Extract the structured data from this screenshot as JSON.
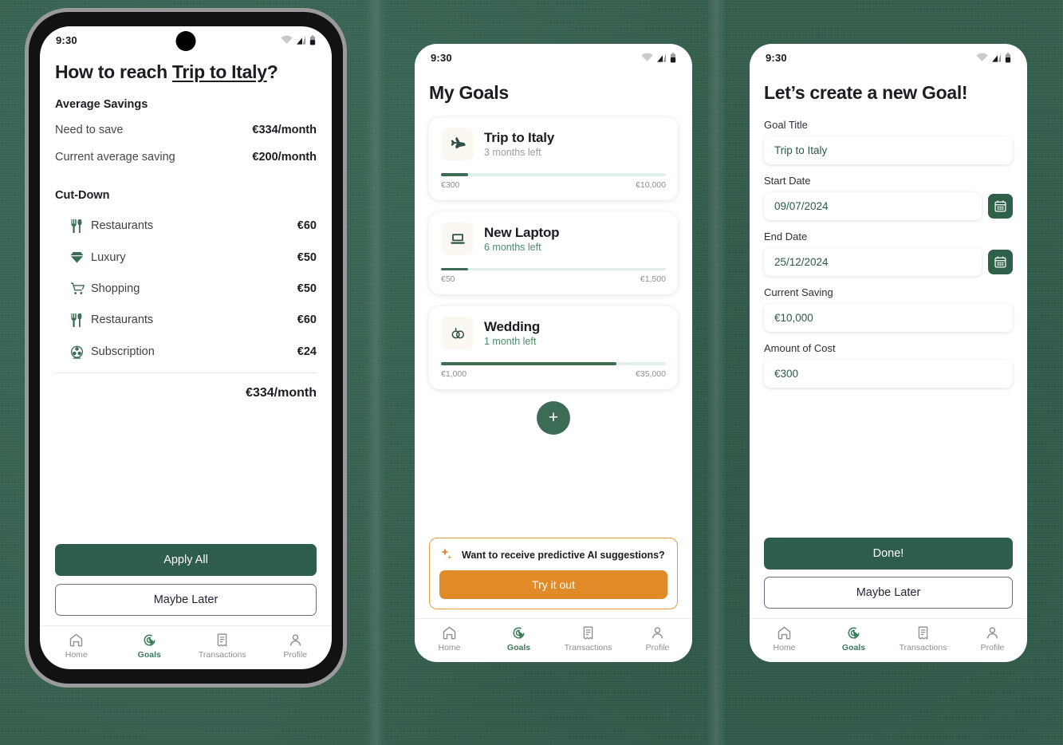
{
  "theme": {
    "background": "#35604f",
    "primary_green": "#2f5d4d",
    "accent_green": "#3c6b56",
    "orange": "#e08b28",
    "tile_cream": "#faf8f0"
  },
  "status_bar": {
    "time": "9:30",
    "icons": [
      "wifi-icon",
      "signal-icon",
      "battery-icon"
    ]
  },
  "bottom_nav": {
    "items": [
      {
        "label": "Home",
        "icon": "home-icon",
        "active": false
      },
      {
        "label": "Goals",
        "icon": "goals-target-icon",
        "active": true
      },
      {
        "label": "Transactions",
        "icon": "receipt-icon",
        "active": false
      },
      {
        "label": "Profile",
        "icon": "person-icon",
        "active": false
      }
    ]
  },
  "screen1": {
    "title_prefix": "How to reach ",
    "title_highlight": "Trip to Italy",
    "title_suffix": "?",
    "average_savings_label": "Average Savings",
    "savings_rows": [
      {
        "label": "Need to save",
        "value": "€334/month"
      },
      {
        "label": "Current average saving",
        "value": "€200/month"
      }
    ],
    "cutdown_label": "Cut-Down",
    "cutdown_rows": [
      {
        "icon": "restaurant-icon",
        "label": "Restaurants",
        "amount": "€60"
      },
      {
        "icon": "diamond-icon",
        "label": "Luxury",
        "amount": "€50"
      },
      {
        "icon": "shopping-cart-icon",
        "label": "Shopping",
        "amount": "€50"
      },
      {
        "icon": "restaurant-icon",
        "label": "Restaurants",
        "amount": "€60"
      },
      {
        "icon": "film-reel-icon",
        "label": "Subscription",
        "amount": "€24"
      }
    ],
    "total": "€334/month",
    "apply_all_label": "Apply All",
    "maybe_later_label": "Maybe Later"
  },
  "screen2": {
    "title": "My Goals",
    "goals": [
      {
        "icon": "airplane-icon",
        "name": "Trip to Italy",
        "time_left": "3 months left",
        "time_left_color": "gray",
        "current": "€300",
        "target": "€10,000",
        "progress_percent": 12
      },
      {
        "icon": "laptop-icon",
        "name": "New Laptop",
        "time_left": "6 months left",
        "time_left_color": "green",
        "current": "€50",
        "target": "€1,500",
        "progress_percent": 12
      },
      {
        "icon": "wedding-rings-icon",
        "name": "Wedding",
        "time_left": "1 month left",
        "time_left_color": "green",
        "current": "€1,000",
        "target": "€35,000",
        "progress_percent": 78
      }
    ],
    "add_goal_label": "+",
    "ai_banner": {
      "icon": "sparkle-icon",
      "question": "Want to receive predictive AI suggestions?",
      "button_label": "Try it out"
    }
  },
  "screen3": {
    "title": "Let’s create a new Goal!",
    "fields": [
      {
        "label": "Goal Title",
        "value": "Trip to Italy",
        "has_calendar": false
      },
      {
        "label": "Start Date",
        "value": "09/07/2024",
        "has_calendar": true
      },
      {
        "label": "End Date",
        "value": "25/12/2024",
        "has_calendar": true
      },
      {
        "label": "Current Saving",
        "value": "€10,000",
        "has_calendar": false
      },
      {
        "label": "Amount of Cost",
        "value": "€300",
        "has_calendar": false
      }
    ],
    "done_label": "Done!",
    "maybe_later_label": "Maybe Later"
  }
}
